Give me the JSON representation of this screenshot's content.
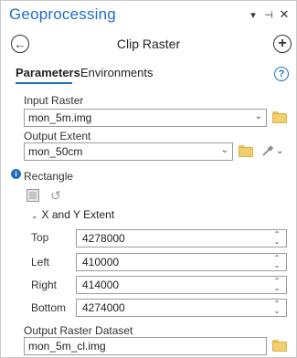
{
  "window": {
    "title": "Geoprocessing",
    "controls": {
      "dropdown": "▾",
      "pin": "⊣",
      "close": "✕"
    }
  },
  "nav": {
    "back_symbol": "←",
    "tool_title": "Clip Raster",
    "add_symbol": "+"
  },
  "tabs": [
    {
      "label": "Parameters",
      "active": true
    },
    {
      "label": "Environments",
      "active": false
    }
  ],
  "help_symbol": "?",
  "fields": {
    "input_raster": {
      "label": "Input Raster",
      "value": "mon_5m.img"
    },
    "output_extent": {
      "label": "Output Extent",
      "value": "mon_50cm"
    },
    "extent_type": "Rectangle",
    "xy_extent": {
      "header": "X and Y Extent",
      "top": {
        "label": "Top",
        "value": "4278000"
      },
      "left": {
        "label": "Left",
        "value": "410000"
      },
      "right": {
        "label": "Right",
        "value": "414000"
      },
      "bottom": {
        "label": "Bottom",
        "value": "4274000"
      }
    },
    "output_raster": {
      "label": "Output Raster Dataset",
      "value": "mon_5m_cl.img"
    }
  },
  "colors": {
    "accent": "#1e6fc2",
    "folder": "#f2cf6e",
    "border": "#9c9c9c"
  },
  "icons": {
    "info": "i",
    "chevron": "⌄",
    "spin_up": "⌃",
    "spin_down": "⌄",
    "caret": "⌄",
    "reset": "↺"
  }
}
